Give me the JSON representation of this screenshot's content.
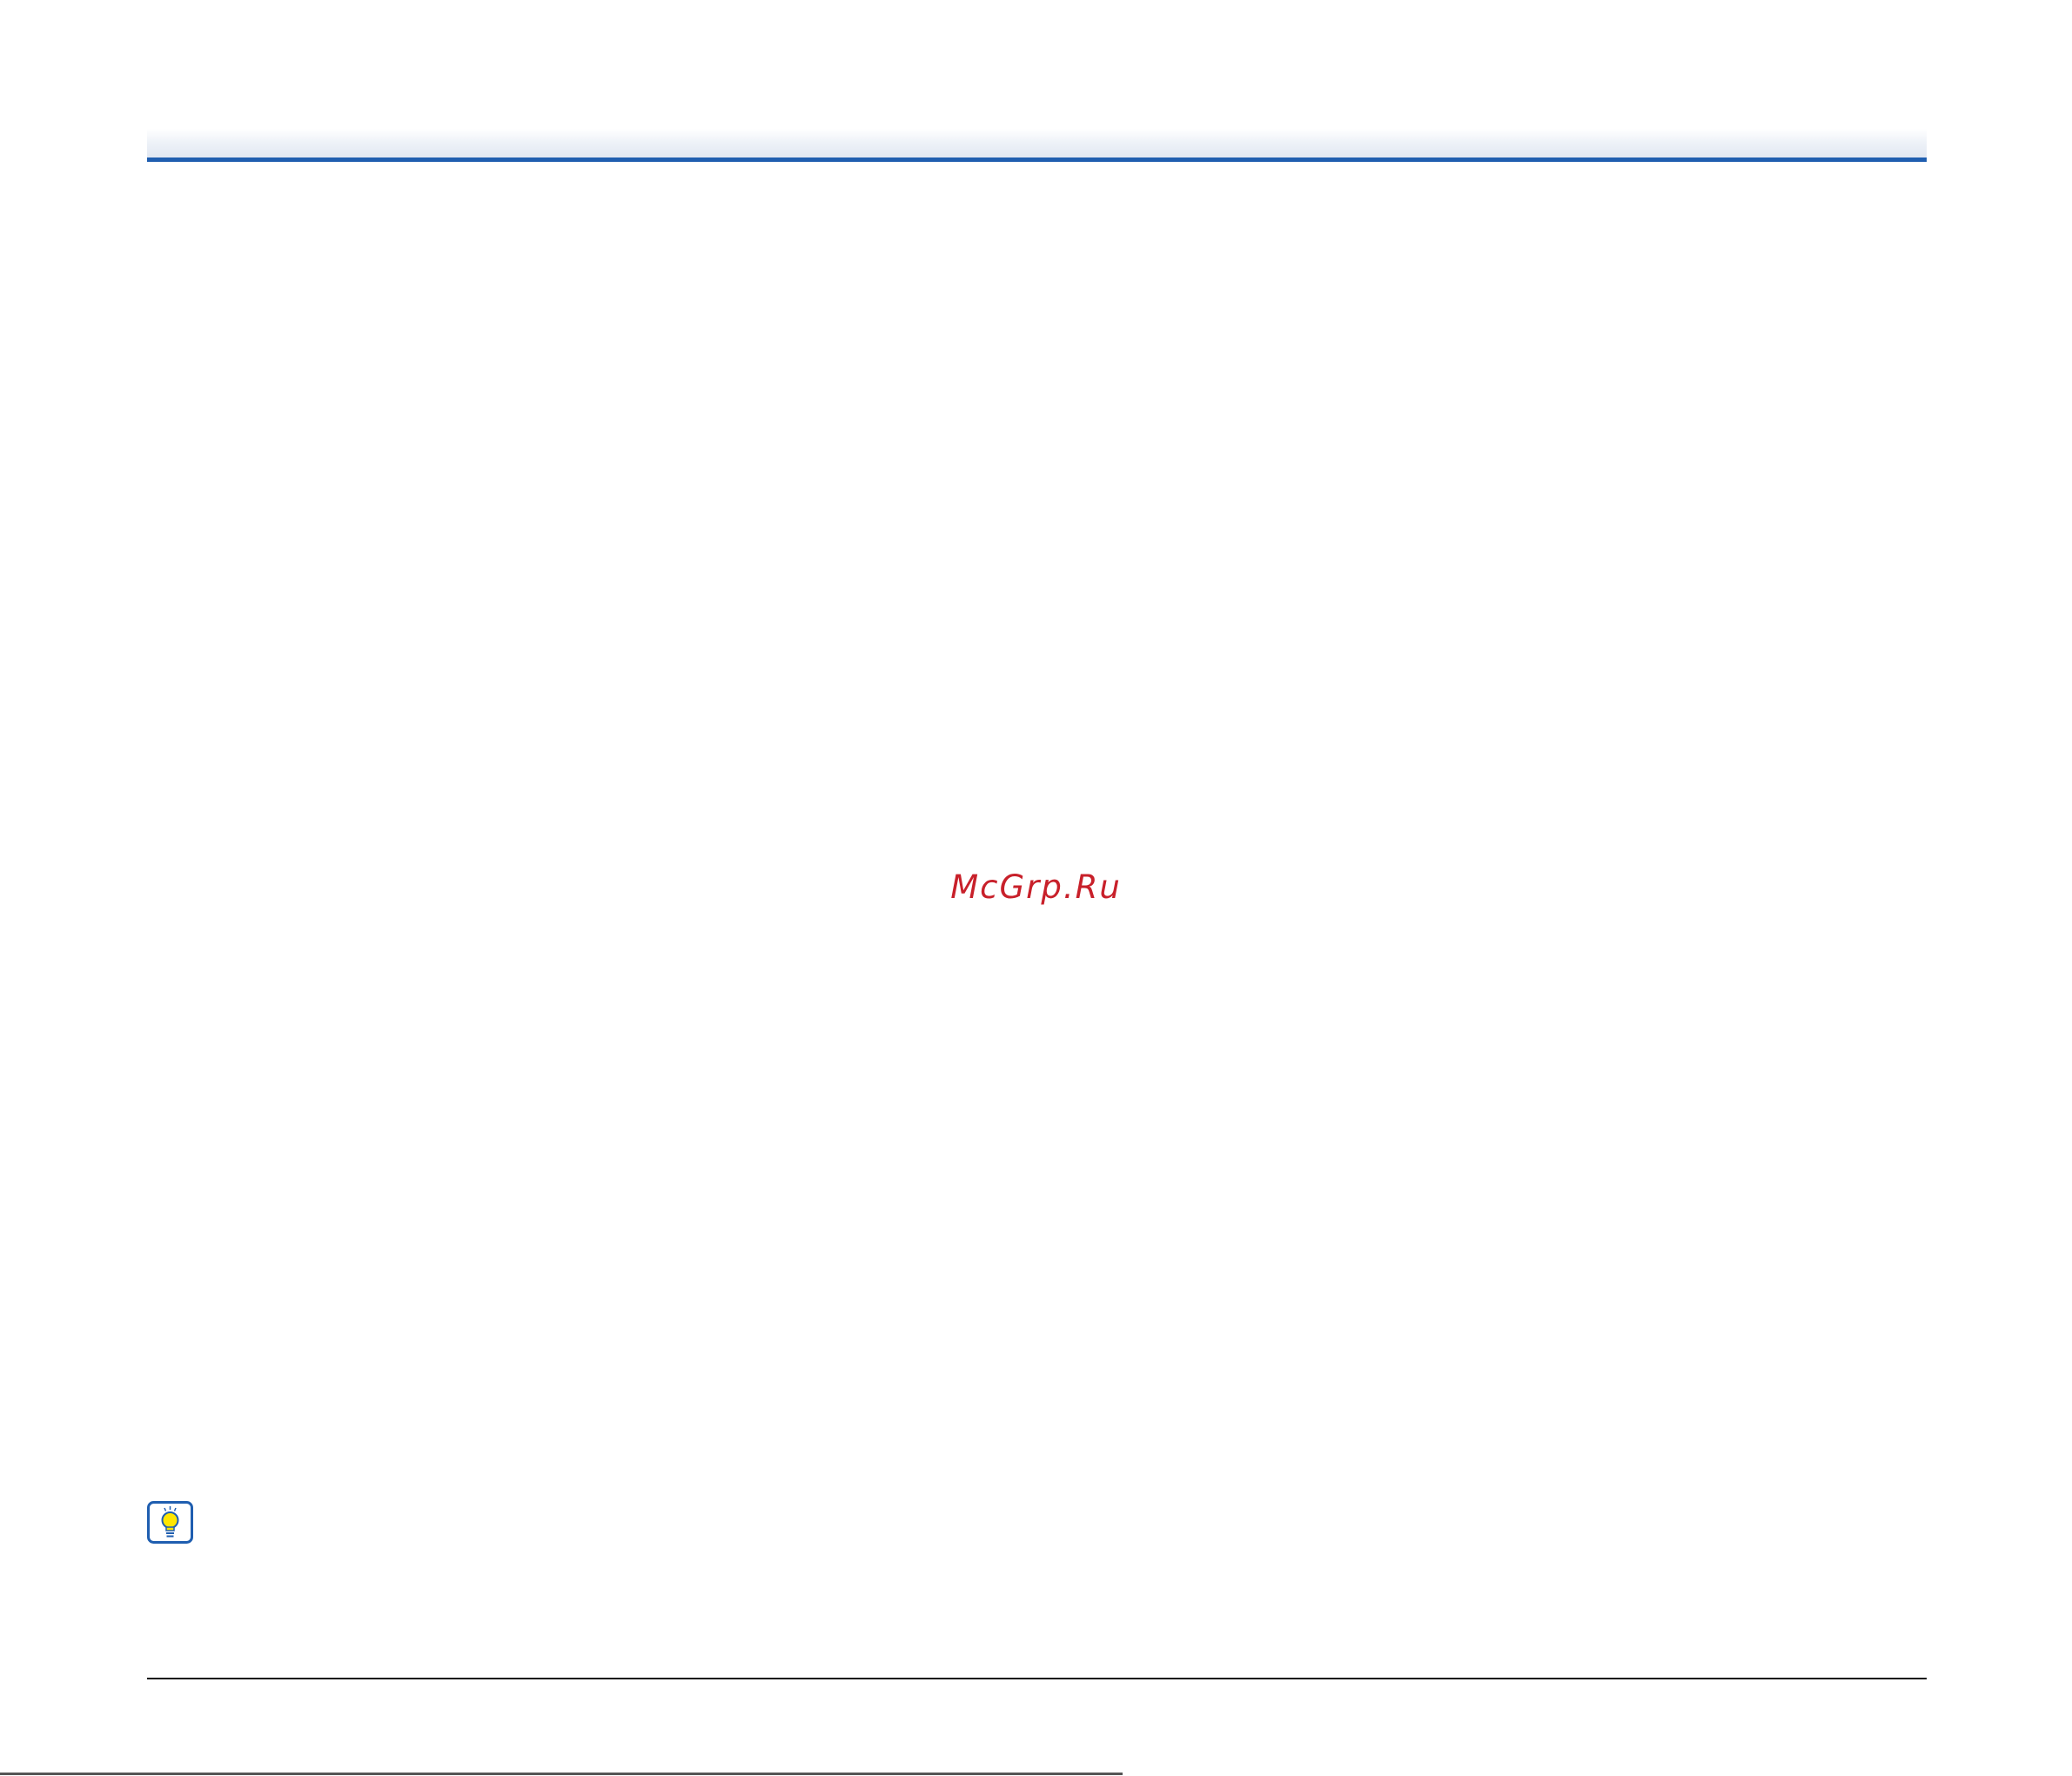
{
  "watermark": {
    "text": "McGrp.Ru",
    "color": "#c8202a"
  },
  "header": {
    "rule_color": "#1f5eb0"
  },
  "hint": {
    "icon": "lightbulb-hint-icon",
    "frame_color": "#1f5eb0",
    "bulb_color": "#ffe600"
  }
}
